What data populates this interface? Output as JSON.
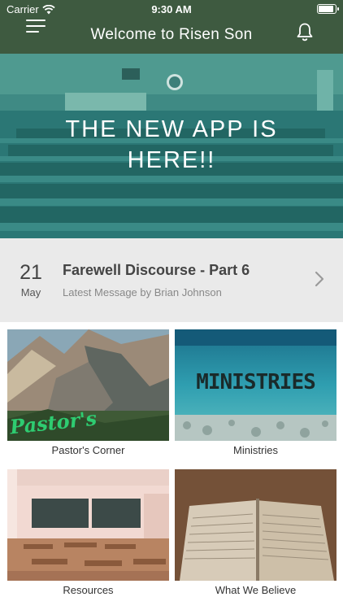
{
  "status": {
    "carrier": "Carrier",
    "time": "9:30 AM"
  },
  "nav": {
    "title": "Welcome to Risen Son"
  },
  "hero": {
    "line1": "THE NEW APP IS",
    "line2": "HERE!!"
  },
  "message": {
    "day": "21",
    "month": "May",
    "title": "Farewell Discourse - Part 6",
    "subtitle": "Latest Message by Brian Johnson"
  },
  "tiles": [
    {
      "label": "Pastor's Corner",
      "overlay": "Pastor's"
    },
    {
      "label": "Ministries",
      "overlay": "MINISTRIES"
    },
    {
      "label": "Resources"
    },
    {
      "label": "What We Believe"
    }
  ],
  "colors": {
    "nav": "#3e5a40",
    "hero": "#2f7f7c",
    "message_bg": "#eaeaea"
  },
  "icons": [
    "wifi-icon",
    "battery-icon",
    "menu-icon",
    "bell-icon",
    "chevron-right-icon"
  ]
}
